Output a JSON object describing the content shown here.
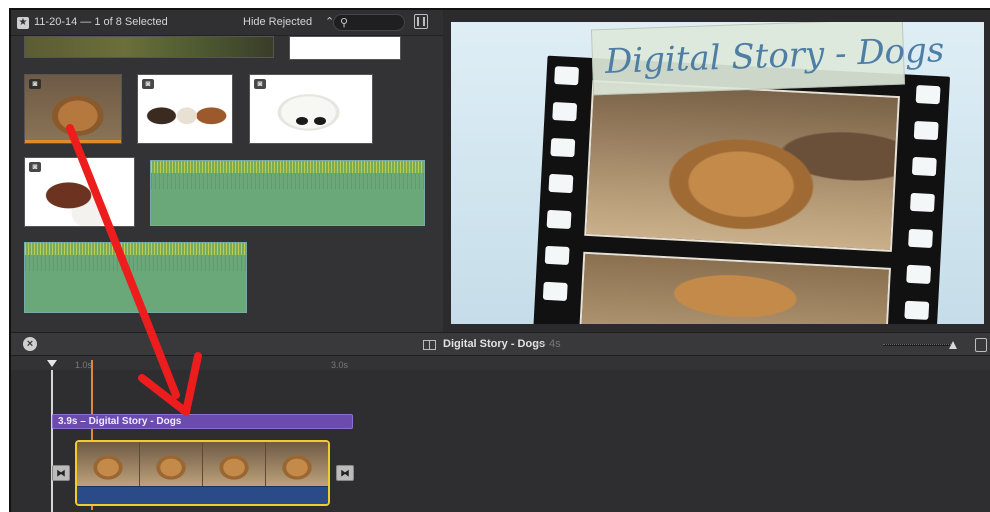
{
  "browser": {
    "event_title": "11-20-14 — 1 of 8 Selected",
    "filter_label": "Hide Rejected",
    "filter_chevron": "⌃⌄",
    "search_placeholder": "",
    "star_icon": "star-icon",
    "search_icon": "magnifier-icon",
    "filmstrip_icon": "filmstrip-icon"
  },
  "viewer": {
    "title": "Digital Story - Dogs"
  },
  "timeline_header": {
    "project_name": "Digital Story - Dogs",
    "project_duration": "— 4s",
    "close_icon": "close-icon"
  },
  "timeline": {
    "ruler": [
      "1.0s",
      "3.0s"
    ],
    "title_clip_label": "3.9s – Digital Story - Dogs",
    "transition_glyph": "⧓"
  },
  "colors": {
    "title_clip": "#6b4cae",
    "selection": "#f0cc2d",
    "annotation_arrow": "#ee1d1d",
    "skimmer": "#e0873a"
  }
}
